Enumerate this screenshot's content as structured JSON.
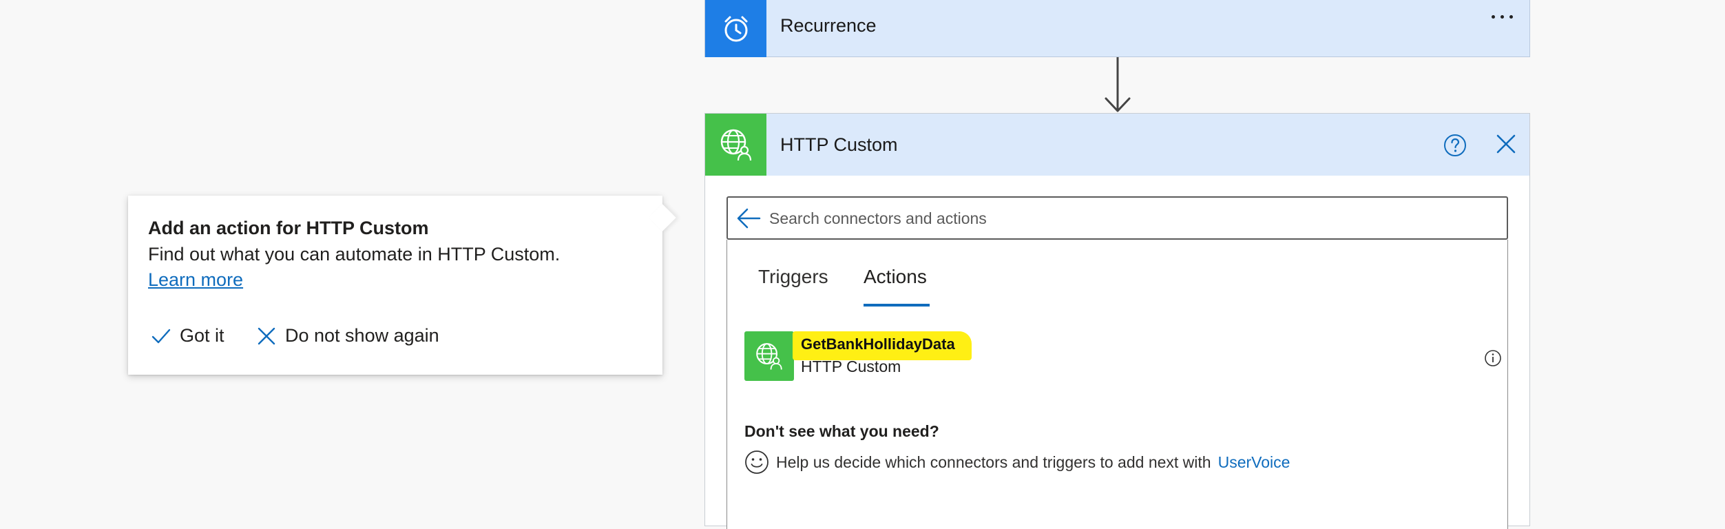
{
  "recurrence_card": {
    "title": "Recurrence",
    "icon": "alarm-clock-icon",
    "more_icon": "more-options-icon"
  },
  "http_card": {
    "title": "HTTP Custom",
    "icon": "globe-user-icon",
    "help_icon": "help-icon",
    "close_icon": "close-icon",
    "search": {
      "placeholder": "Search connectors and actions",
      "value": ""
    },
    "tabs": [
      {
        "label": "Triggers",
        "selected": false
      },
      {
        "label": "Actions",
        "selected": true
      }
    ],
    "actions": [
      {
        "name": "GetBankHollidayData",
        "connector": "HTTP Custom",
        "highlighted": true
      }
    ],
    "dont_see_heading": "Don't see what you need?",
    "help_text": "Help us decide which connectors and triggers to add next with",
    "help_link": "UserVoice"
  },
  "callout": {
    "title": "Add an action for HTTP Custom",
    "body": "Find out what you can automate in HTTP Custom.",
    "link": "Learn more",
    "got_it_label": "Got it",
    "dont_show_label": "Do not show again"
  },
  "colors": {
    "background": "#f8f8f8",
    "card_header": "#dbe9fb",
    "recurrence_icon_bg": "#1e7ee6",
    "http_icon_bg": "#45c14a",
    "accent": "#0f6cbd",
    "highlight": "#ffef14"
  }
}
